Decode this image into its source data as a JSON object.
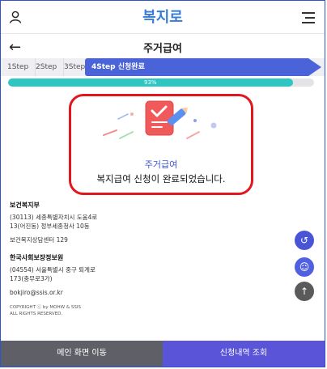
{
  "header": {
    "logo_text": "복지로"
  },
  "titlebar": {
    "back_icon": "arrow-left-icon",
    "title": "주거급여"
  },
  "steps": [
    "1Step",
    "2Step",
    "3Step",
    "4Step 신청완료"
  ],
  "progress": {
    "value": 0.93,
    "label": "93%"
  },
  "completion": {
    "subtitle": "주거급여",
    "message": "복지급여 신청이 완료되었습니다."
  },
  "footer_info": {
    "org1_name": "보건복지부",
    "org1_address_line1": "(30113) 세종특별자치시 도움4로",
    "org1_address_line2": "13(어진동) 정부세종청사 10동",
    "org1_center": "보건복지상담센터 129",
    "org2_name": "한국사회보장정보원",
    "org2_address_line1": "(04554) 서울특별시 중구 퇴계로",
    "org2_address_line2": "173(충무로3가)",
    "email": "bokjiro@ssis.or.kr",
    "copyright_line1": "COPYRIGHT ⓒ by MOHW & SSIS",
    "copyright_line2": "ALL RIGHTS RESERVED."
  },
  "bottom_buttons": {
    "main": "메인 화면 이동",
    "history": "신청내역 조회"
  },
  "colors": {
    "primary": "#4a63d8",
    "progress": "#2ec6c2",
    "highlight_border": "#e2161d"
  }
}
